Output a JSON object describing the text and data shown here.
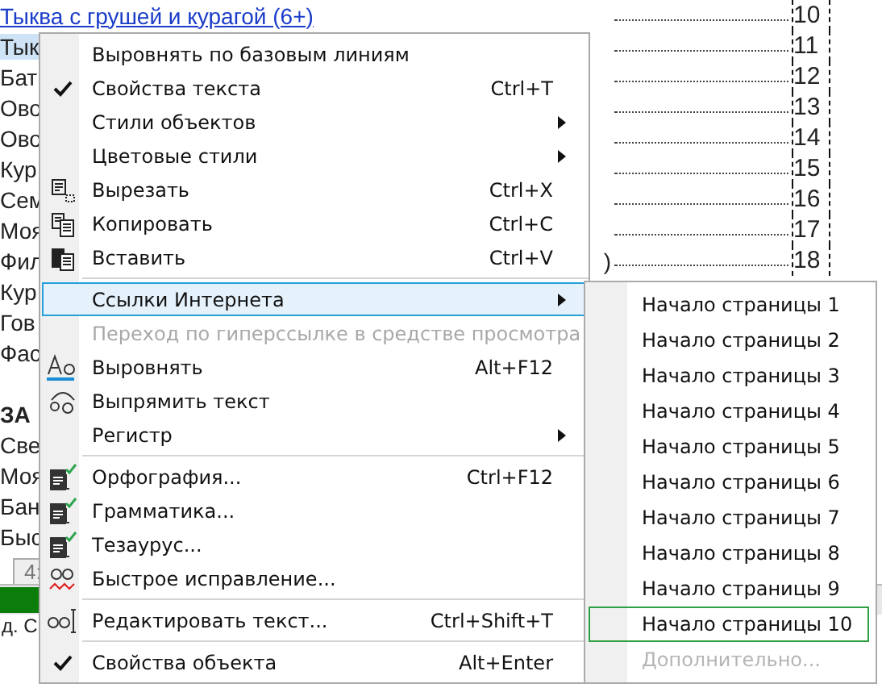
{
  "document": {
    "rows": [
      {
        "kind": "link",
        "text": "Тыква с грушей и курагой (6+)",
        "page": "10",
        "selected": false
      },
      {
        "kind": "entry",
        "text": "Тык",
        "page": "11",
        "selected": true
      },
      {
        "kind": "entry",
        "text": "Бат",
        "page": "12",
        "selected": false
      },
      {
        "kind": "entry",
        "text": "Ово",
        "page": "13",
        "selected": false
      },
      {
        "kind": "entry",
        "text": "Ово",
        "page": "14",
        "selected": false
      },
      {
        "kind": "entry",
        "text": "Кур",
        "page": "15",
        "selected": false
      },
      {
        "kind": "entry",
        "text": "Сем",
        "page": "16",
        "selected": false
      },
      {
        "kind": "entry",
        "text": "Моя",
        "page": "17",
        "selected": false
      },
      {
        "kind": "entry",
        "text": "Фил",
        "tail": ")",
        "page": "18",
        "selected": false
      },
      {
        "kind": "entry",
        "text": "Кур",
        "selected": false
      },
      {
        "kind": "entry",
        "text": "Гов",
        "selected": false
      },
      {
        "kind": "entry",
        "text": "Фас",
        "selected": false
      },
      {
        "kind": "heading",
        "text": "ЗА",
        "selected": false
      },
      {
        "kind": "entry",
        "text": "Све",
        "selected": false
      },
      {
        "kind": "entry",
        "text": "Моя",
        "selected": false
      },
      {
        "kind": "entry",
        "text": "Бан",
        "selected": false
      },
      {
        "kind": "entry",
        "text": "Быс",
        "selected": false
      }
    ],
    "page_tab": "4:",
    "status_text": "д. С"
  },
  "context_menu": {
    "items": [
      {
        "kind": "item",
        "label": "Выровнять по базовым линиям",
        "checked": false,
        "disabled": false,
        "selected": false,
        "submenu": false
      },
      {
        "kind": "item",
        "label": "Свойства текста",
        "shortcut": "Ctrl+T",
        "checked": true,
        "disabled": false,
        "selected": false,
        "submenu": false
      },
      {
        "kind": "item",
        "label": "Стили объектов",
        "checked": false,
        "disabled": false,
        "selected": false,
        "submenu": true
      },
      {
        "kind": "item",
        "label": "Цветовые стили",
        "checked": false,
        "disabled": false,
        "selected": false,
        "submenu": true
      },
      {
        "kind": "item",
        "label": "Вырезать",
        "shortcut": "Ctrl+X",
        "checked": false,
        "disabled": false,
        "selected": false,
        "submenu": false
      },
      {
        "kind": "item",
        "label": "Копировать",
        "shortcut": "Ctrl+C",
        "checked": false,
        "disabled": false,
        "selected": false,
        "submenu": false
      },
      {
        "kind": "item",
        "label": "Вставить",
        "shortcut": "Ctrl+V",
        "checked": false,
        "disabled": false,
        "selected": false,
        "submenu": false
      },
      {
        "kind": "separator"
      },
      {
        "kind": "item",
        "label": "Ссылки Интернета",
        "checked": false,
        "disabled": false,
        "selected": true,
        "submenu": true
      },
      {
        "kind": "item",
        "label": "Переход по гиперссылке в средстве просмотра",
        "checked": false,
        "disabled": true,
        "selected": false,
        "submenu": false
      },
      {
        "kind": "item",
        "label": "Выровнять",
        "shortcut": "Alt+F12",
        "checked": false,
        "disabled": false,
        "selected": false,
        "submenu": false
      },
      {
        "kind": "item",
        "label": "Выпрямить текст",
        "checked": false,
        "disabled": false,
        "selected": false,
        "submenu": false
      },
      {
        "kind": "item",
        "label": "Регистр",
        "checked": false,
        "disabled": false,
        "selected": false,
        "submenu": true
      },
      {
        "kind": "separator"
      },
      {
        "kind": "item",
        "label": "Орфография...",
        "shortcut": "Ctrl+F12",
        "checked": false,
        "disabled": false,
        "selected": false,
        "submenu": false
      },
      {
        "kind": "item",
        "label": "Грамматика...",
        "checked": false,
        "disabled": false,
        "selected": false,
        "submenu": false
      },
      {
        "kind": "item",
        "label": "Тезаурус...",
        "checked": false,
        "disabled": false,
        "selected": false,
        "submenu": false
      },
      {
        "kind": "item",
        "label": "Быстрое исправление...",
        "checked": false,
        "disabled": false,
        "selected": false,
        "submenu": false
      },
      {
        "kind": "separator"
      },
      {
        "kind": "item",
        "label": "Редактировать текст...",
        "shortcut": "Ctrl+Shift+T",
        "checked": false,
        "disabled": false,
        "selected": false,
        "submenu": false
      },
      {
        "kind": "separator"
      },
      {
        "kind": "item",
        "label": "Свойства объекта",
        "shortcut": "Alt+Enter",
        "checked": true,
        "disabled": false,
        "selected": false,
        "submenu": false
      }
    ]
  },
  "submenu": {
    "items": [
      {
        "label": "Начало страницы 1",
        "disabled": false,
        "focused": false
      },
      {
        "label": "Начало страницы 2",
        "disabled": false,
        "focused": false
      },
      {
        "label": "Начало страницы 3",
        "disabled": false,
        "focused": false
      },
      {
        "label": "Начало страницы 4",
        "disabled": false,
        "focused": false
      },
      {
        "label": "Начало страницы 5",
        "disabled": false,
        "focused": false
      },
      {
        "label": "Начало страницы 6",
        "disabled": false,
        "focused": false
      },
      {
        "label": "Начало страницы 7",
        "disabled": false,
        "focused": false
      },
      {
        "label": "Начало страницы 8",
        "disabled": false,
        "focused": false
      },
      {
        "label": "Начало страницы 9",
        "disabled": false,
        "focused": false
      },
      {
        "label": "Начало страницы 10",
        "disabled": false,
        "focused": true
      },
      {
        "label": "Дополнительно...",
        "disabled": true,
        "focused": false
      }
    ]
  }
}
